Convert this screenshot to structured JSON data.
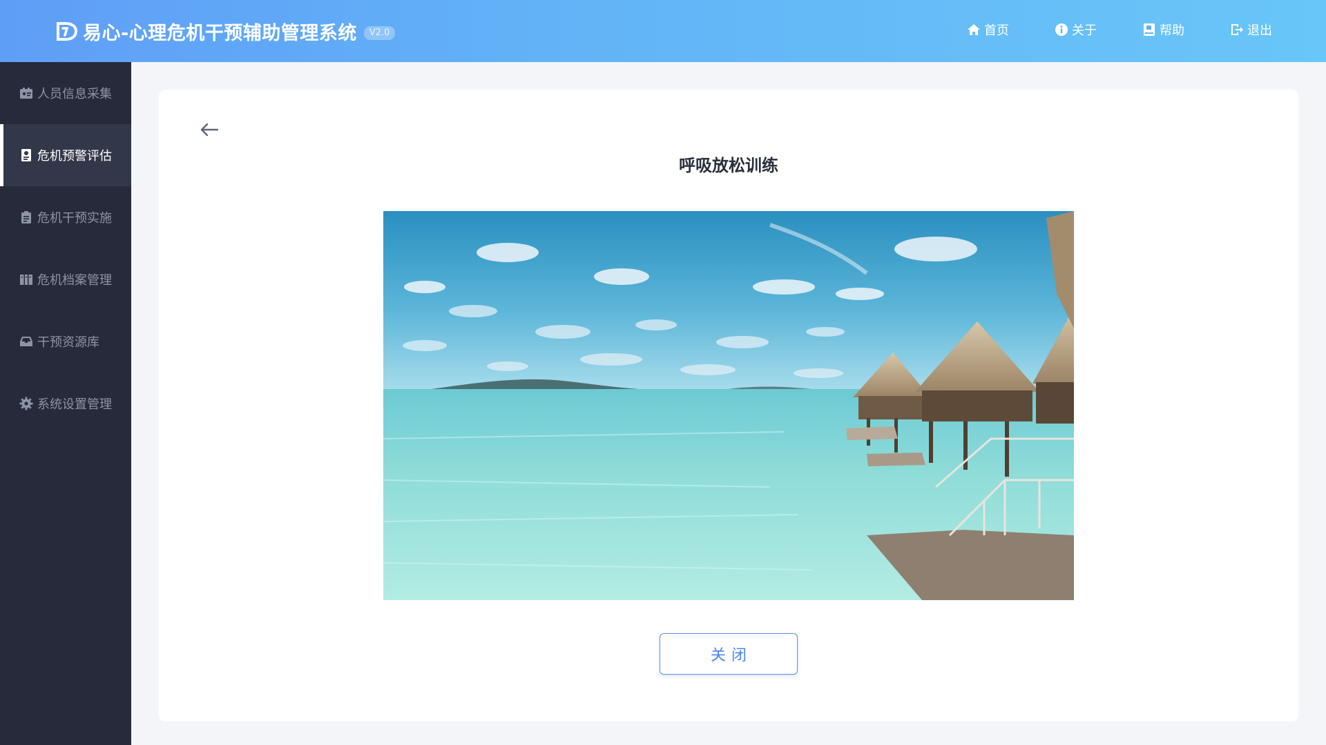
{
  "header": {
    "app_title": "易心-心理危机干预辅助管理系统",
    "version": "V2.0",
    "nav": [
      {
        "label": "首页",
        "icon": "home-icon"
      },
      {
        "label": "关于",
        "icon": "info-icon"
      },
      {
        "label": "帮助",
        "icon": "book-icon"
      },
      {
        "label": "退出",
        "icon": "logout-icon"
      }
    ]
  },
  "sidebar": {
    "items": [
      {
        "label": "人员信息采集",
        "icon": "id-card-icon",
        "active": false
      },
      {
        "label": "危机预警评估",
        "icon": "assessment-icon",
        "active": true
      },
      {
        "label": "危机干预实施",
        "icon": "clipboard-icon",
        "active": false
      },
      {
        "label": "危机档案管理",
        "icon": "archive-icon",
        "active": false
      },
      {
        "label": "干预资源库",
        "icon": "inbox-icon",
        "active": false
      },
      {
        "label": "系统设置管理",
        "icon": "gear-icon",
        "active": false
      }
    ]
  },
  "main": {
    "title": "呼吸放松训练",
    "close_label": "关闭"
  },
  "colors": {
    "header_start": "#5f9ef7",
    "header_end": "#69c6f8",
    "sidebar_bg": "#262a3a",
    "sidebar_active": "#323749",
    "accent": "#4a86ee"
  }
}
